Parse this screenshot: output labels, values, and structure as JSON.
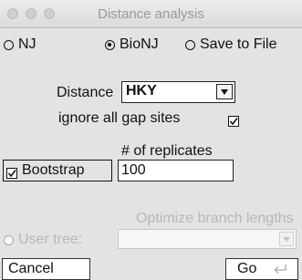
{
  "window": {
    "title": "Distance analysis"
  },
  "method": {
    "options": [
      {
        "label": "NJ",
        "selected": false
      },
      {
        "label": "BioNJ",
        "selected": true
      },
      {
        "label": "Save to File",
        "selected": false
      }
    ]
  },
  "distance": {
    "label": "Distance",
    "value": "HKY"
  },
  "ignore_gaps": {
    "label": "ignore all gap sites",
    "checked": true
  },
  "bootstrap": {
    "label": "Bootstrap",
    "checked": true,
    "replicates_label": "# of replicates",
    "replicates_value": "100"
  },
  "user_tree": {
    "label": "User tree:",
    "optimize_label": "Optimize branch lengths",
    "enabled": false
  },
  "buttons": {
    "cancel": "Cancel",
    "go": "Go"
  }
}
